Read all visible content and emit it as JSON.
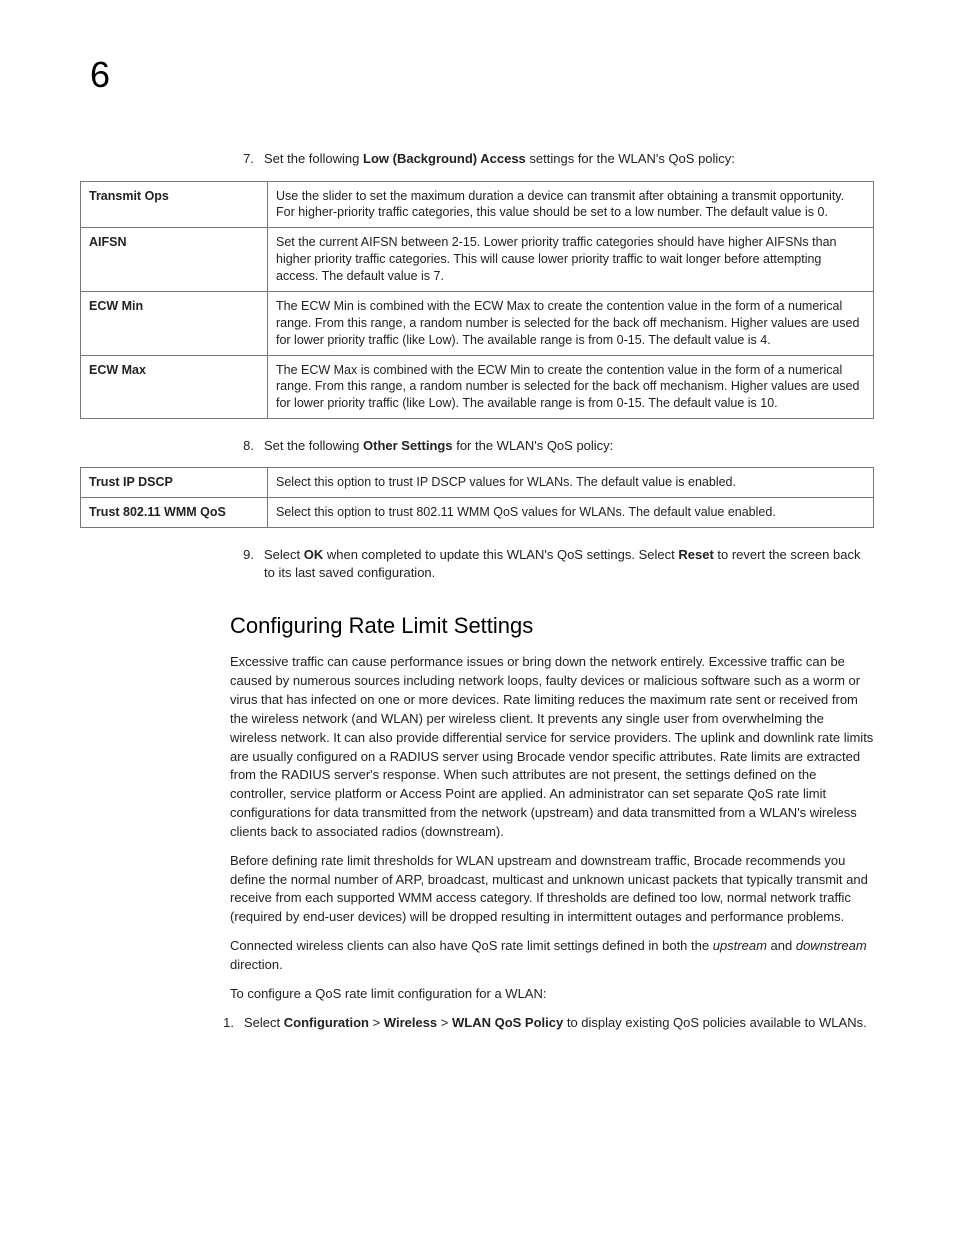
{
  "chapter": "6",
  "step7": {
    "num": "7.",
    "pre": "Set the following ",
    "bold": "Low (Background) Access",
    "post": " settings for the WLAN's QoS policy:"
  },
  "table1": [
    {
      "h": "Transmit Ops",
      "d": "Use the slider to set the maximum duration a device can transmit after obtaining a transmit opportunity. For higher-priority traffic categories, this value should be set to a low number. The default value is 0."
    },
    {
      "h": "AIFSN",
      "d": "Set the current AIFSN between 2-15. Lower priority traffic categories should have higher AIFSNs than higher priority traffic categories. This will cause lower priority traffic to wait longer before attempting access. The default value is 7."
    },
    {
      "h": "ECW Min",
      "d": "The ECW Min is combined with the ECW Max to create the contention value in the form of a numerical range. From this range, a random number is selected for the back off mechanism. Higher values are used for lower priority traffic (like Low). The available range is from 0-15. The default value is 4."
    },
    {
      "h": "ECW Max",
      "d": "The ECW Max is combined with the ECW Min to create the contention value in the form of a numerical range. From this range, a random number is selected for the back off mechanism. Higher values are used for lower priority traffic (like Low). The available range is from 0-15. The default value is 10."
    }
  ],
  "step8": {
    "num": "8.",
    "pre": "Set the following ",
    "bold": "Other Settings",
    "post": " for the WLAN's QoS policy:"
  },
  "table2": [
    {
      "h": "Trust IP DSCP",
      "d": "Select this option to trust IP DSCP values for WLANs. The default value is enabled."
    },
    {
      "h": "Trust 802.11 WMM QoS",
      "d": "Select this option to trust 802.11 WMM QoS values for WLANs. The default value enabled."
    }
  ],
  "step9": {
    "num": "9.",
    "pre": "Select ",
    "b1": "OK",
    "mid": " when completed to update this WLAN's QoS settings. Select ",
    "b2": "Reset",
    "post": " to revert the screen back to its last saved configuration."
  },
  "sectionTitle": "Configuring Rate Limit Settings",
  "para1": "Excessive traffic can cause performance issues or bring down the network entirely. Excessive traffic can be caused by numerous sources including network loops, faulty devices or malicious software such as a worm or virus that has infected on one or more devices. Rate limiting reduces the maximum rate sent or received from the wireless network (and WLAN) per wireless client. It prevents any single user from overwhelming the wireless network. It can also provide differential service for service providers. The uplink and downlink rate limits are usually configured on a RADIUS server using Brocade vendor specific attributes. Rate limits are extracted from the RADIUS server's response. When such attributes are not present, the settings defined on the controller, service platform or Access Point are applied. An administrator can set separate QoS rate limit configurations for data transmitted from the network (upstream) and data transmitted from a WLAN's wireless clients back to associated radios (downstream).",
  "para2": "Before defining rate limit thresholds for WLAN upstream and downstream traffic, Brocade recommends you define the normal number of ARP, broadcast, multicast and unknown unicast packets that typically transmit and receive from each supported WMM access category. If thresholds are defined too low, normal network traffic (required by end-user devices) will be dropped resulting in intermittent outages and performance problems.",
  "para3_pre": "Connected wireless clients can also have QoS rate limit settings defined in both the ",
  "para3_i1": "upstream",
  "para3_mid": " and ",
  "para3_i2": "downstream",
  "para3_post": " direction.",
  "para4": "To configure a QoS rate limit configuration for a WLAN:",
  "step1": {
    "num": "1.",
    "pre": "Select ",
    "b1": "Configuration",
    "gt1": " > ",
    "b2": "Wireless",
    "gt2": " > ",
    "b3": "WLAN QoS Policy",
    "post": " to display existing QoS policies available to WLANs."
  }
}
